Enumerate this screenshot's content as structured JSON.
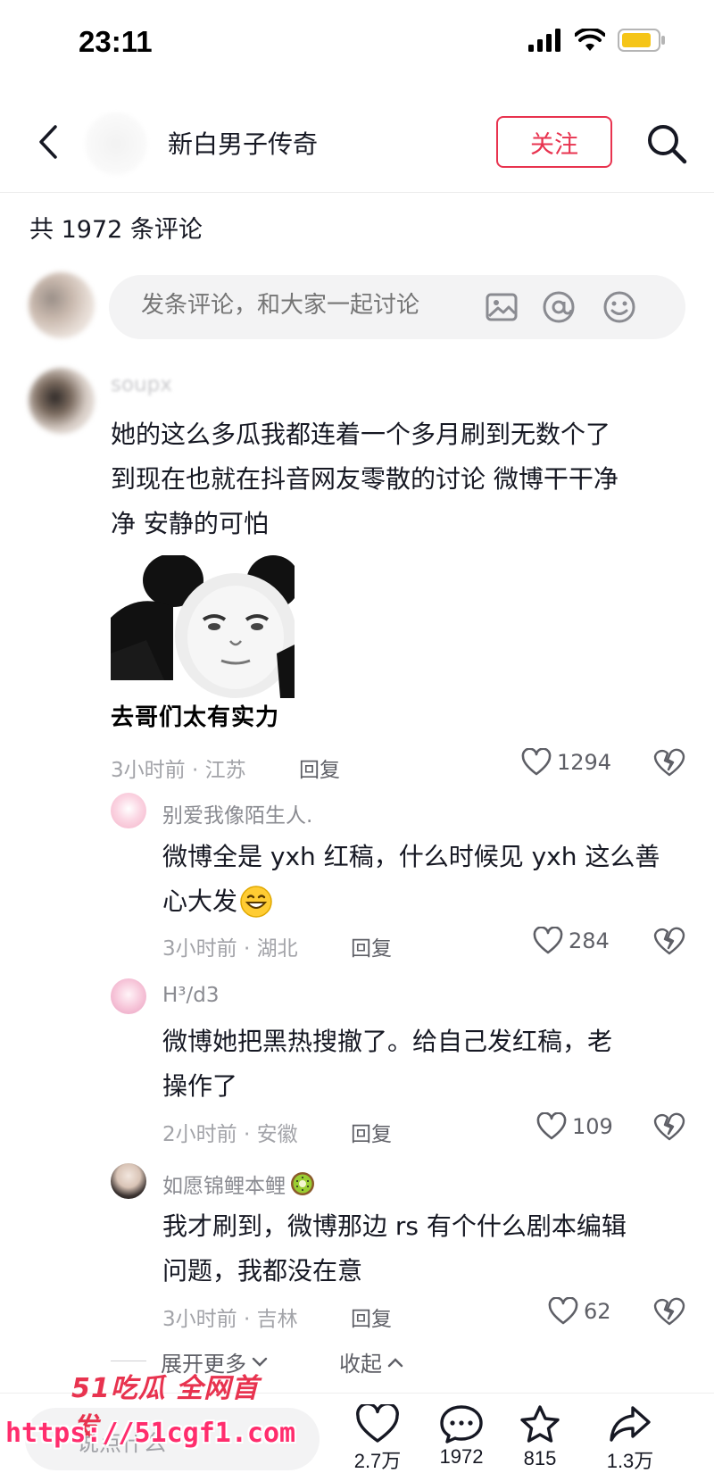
{
  "status_bar": {
    "time": "23:11"
  },
  "header": {
    "title": "新白男子传奇",
    "follow_label": "关注"
  },
  "comment_count": "共 1972 条评论",
  "composer": {
    "placeholder": "发条评论，和大家一起讨论"
  },
  "comments": [
    {
      "username": "soupx",
      "text_lines": [
        "她的这么多瓜我都连着一个多月刷到无数个了",
        "到现在也就在抖音网友零散的讨论  微博干干净",
        "净  安静的可怕"
      ],
      "meme_caption": "去哥们太有实力",
      "time_location": "3小时前 · 江苏",
      "reply_label": "回复",
      "likes": "1294"
    },
    {
      "username": "别爱我像陌生人.",
      "text_lines": [
        "微博全是 yxh 红稿，什么时候见 yxh 这么善",
        "心大发"
      ],
      "time_location": "3小时前 · 湖北",
      "reply_label": "回复",
      "likes": "284"
    },
    {
      "username": "H³/d3",
      "text_lines": [
        "微博她把黑热搜撤了。给自己发红稿，老",
        "操作了"
      ],
      "time_location": "2小时前 · 安徽",
      "reply_label": "回复",
      "likes": "109"
    },
    {
      "username": "如愿锦鲤本鲤",
      "text_lines": [
        "我才刷到，微博那边 rs 有个什么剧本编辑",
        "问题，我都没在意"
      ],
      "time_location": "3小时前 · 吉林",
      "reply_label": "回复",
      "likes": "62"
    }
  ],
  "expand_more_label": "展开更多",
  "collapse_label": "收起",
  "bottom_bar": {
    "input_placeholder": "说点什么",
    "likes": "2.7万",
    "comments": "1972",
    "favorites": "815",
    "shares": "1.3万"
  },
  "watermark": {
    "top_text": "51吃瓜 全网首发",
    "url": "https://51cgf1.com"
  },
  "colors": {
    "accent": "#e8334f",
    "text": "#161823",
    "muted": "#a2a3a8"
  }
}
